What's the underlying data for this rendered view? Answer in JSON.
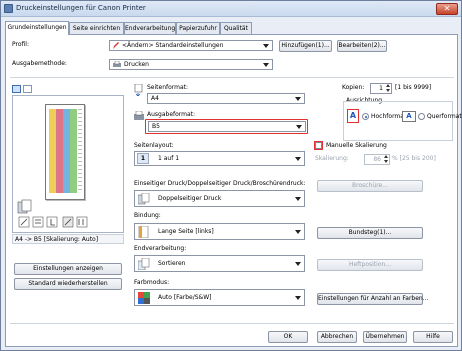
{
  "window": {
    "title": "Druckeinstellungen für Canon Printer",
    "close_label": "✕"
  },
  "tabs": [
    "Grundeinstellungen",
    "Seite einrichten",
    "Endverarbeitung",
    "Papierzufuhr",
    "Qualität"
  ],
  "profile": {
    "label": "Profil:",
    "value": "<Ändern> Standardeinstellungen",
    "add_button": "Hinzufügen(1)...",
    "edit_button": "Bearbeiten(2)..."
  },
  "output_method": {
    "label": "Ausgabemethode:",
    "value": "Drucken"
  },
  "preview": {
    "caption": "A4 -> B5 [Skalierung: Auto]",
    "show_settings_button": "Einstellungen anzeigen",
    "restore_defaults_button": "Standard wiederherstellen"
  },
  "page_size": {
    "label": "Seitenformat:",
    "value": "A4"
  },
  "output_size": {
    "label": "Ausgabeformat:",
    "value": "B5"
  },
  "copies": {
    "label": "Kopien:",
    "value": "1",
    "range": "[1 bis 9999]"
  },
  "orientation": {
    "label": "Ausrichtung",
    "portrait": "Hochformat",
    "landscape": "Querformat",
    "selected": "Hochformat"
  },
  "page_layout": {
    "label": "Seitenlayout:",
    "value": "1 auf 1",
    "icon_text": "1"
  },
  "manual_scaling": {
    "label": "Manuelle Skalierung",
    "checked": false
  },
  "scaling": {
    "label": "Skalierung:",
    "value": "86",
    "range": "% [25 bis 200]"
  },
  "duplex": {
    "label": "Einseitiger Druck/Doppelseitiger Druck/Broschürendruck:",
    "value": "Doppelseitiger Druck"
  },
  "booklet_button": "Broschüre...",
  "binding": {
    "label": "Bindung:",
    "value": "Lange Seite [links]"
  },
  "gutter_button": "Bundsteg(1)...",
  "finishing": {
    "label": "Endverarbeitung:",
    "value": "Sortieren"
  },
  "staple_button": "Heftposition...",
  "color_mode": {
    "label": "Farbmodus:",
    "value": "Auto [Farbe/S&W]"
  },
  "color_settings_button": "Einstellungen für Anzahl an Farben...",
  "footer": {
    "ok": "OK",
    "cancel": "Abbrechen",
    "apply": "Übernehmen",
    "help": "Hilfe"
  },
  "colors": {
    "highlight_red": "#e03030",
    "accent_blue": "#1d57b8"
  }
}
